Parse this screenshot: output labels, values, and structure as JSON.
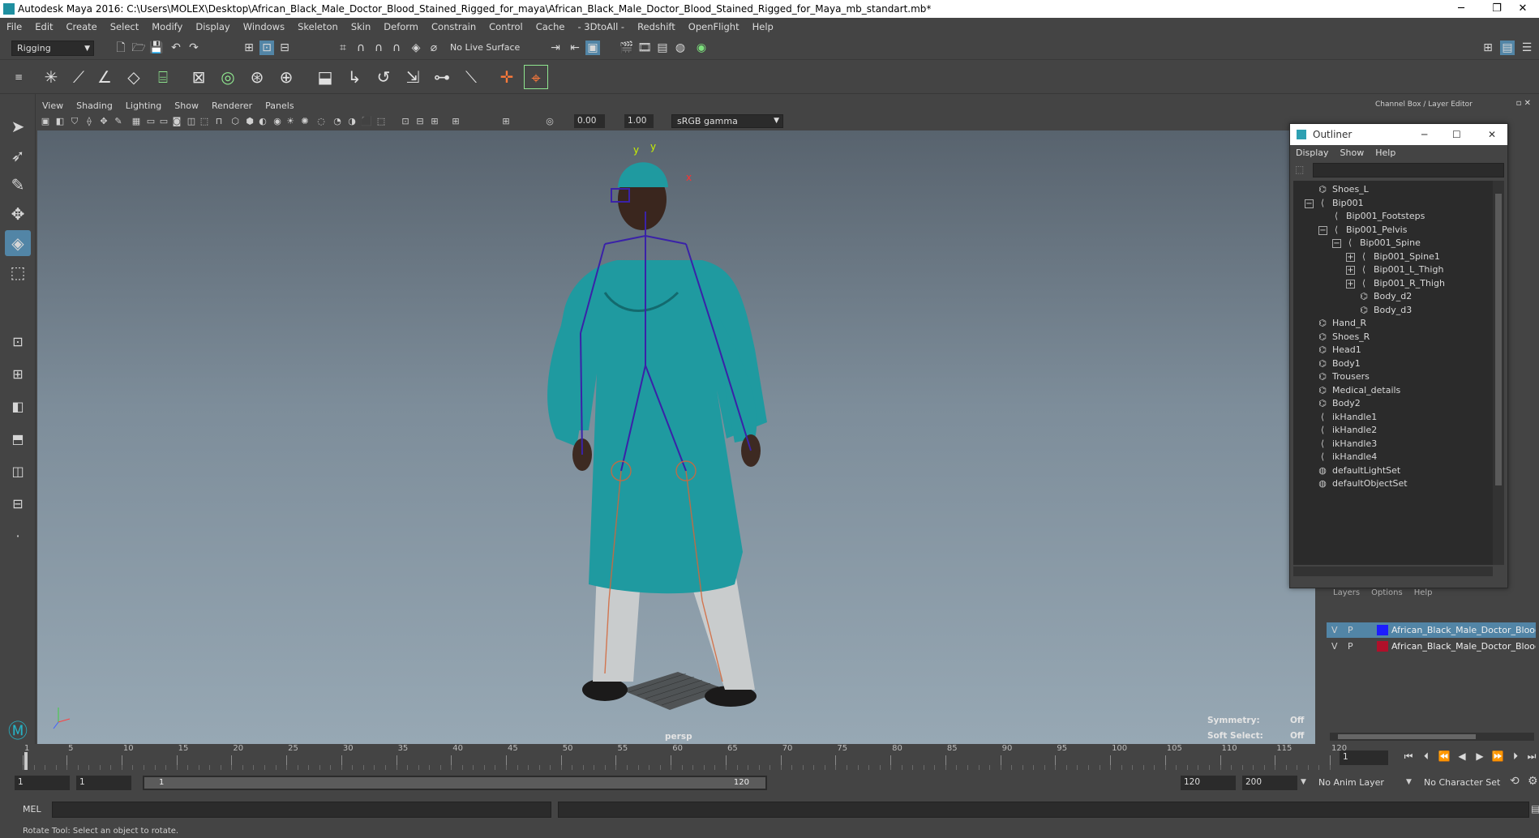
{
  "window": {
    "title": "Autodesk Maya 2016: C:\\Users\\MOLEX\\Desktop\\African_Black_Male_Doctor_Blood_Stained_Rigged_for_maya\\African_Black_Male_Doctor_Blood_Stained_Rigged_for_Maya_mb_standart.mb*",
    "minimize": "─",
    "restore": "❐",
    "close": "✕"
  },
  "menubar": [
    "File",
    "Edit",
    "Create",
    "Select",
    "Modify",
    "Display",
    "Windows",
    "Skeleton",
    "Skin",
    "Deform",
    "Constrain",
    "Control",
    "Cache",
    "- 3DtoAll -",
    "Redshift",
    "OpenFlight",
    "Help"
  ],
  "statusline": {
    "menuset": "Rigging",
    "live_surface": "No Live Surface"
  },
  "viewport_panel": {
    "menus": [
      "View",
      "Shading",
      "Lighting",
      "Show",
      "Renderer",
      "Panels"
    ],
    "exposure": "0.00",
    "gamma": "1.00",
    "color_space": "sRGB gamma",
    "camera_label": "persp",
    "symmetry_label": "Symmetry:",
    "symmetry_value": "Off",
    "soft_select_label": "Soft Select:",
    "soft_select_value": "Off"
  },
  "channelbox": {
    "title": "Channel Box / Layer Editor",
    "layer_menus": [
      "Layers",
      "Options",
      "Help"
    ],
    "layers": [
      {
        "v": "V",
        "p": "P",
        "color": "#1d1dff",
        "name": "African_Black_Male_Doctor_Blood_Stained",
        "selected": true
      },
      {
        "v": "V",
        "p": "P",
        "color": "#b0102a",
        "name": "African_Black_Male_Doctor_Blood",
        "selected": false
      }
    ]
  },
  "outliner": {
    "title": "Outliner",
    "menus": [
      "Display",
      "Show",
      "Help"
    ],
    "items": [
      {
        "label": "Shoes_L",
        "indent": 0,
        "icon": "mesh-icon"
      },
      {
        "label": "Bip001",
        "indent": 0,
        "icon": "joint-icon",
        "expander": "−"
      },
      {
        "label": "Bip001_Footsteps",
        "indent": 1,
        "icon": "joint-icon"
      },
      {
        "label": "Bip001_Pelvis",
        "indent": 1,
        "icon": "joint-icon",
        "expander": "−"
      },
      {
        "label": "Bip001_Spine",
        "indent": 2,
        "icon": "joint-icon",
        "expander": "−"
      },
      {
        "label": "Bip001_Spine1",
        "indent": 3,
        "icon": "joint-icon",
        "expander": "+"
      },
      {
        "label": "Bip001_L_Thigh",
        "indent": 3,
        "icon": "joint-icon",
        "expander": "+"
      },
      {
        "label": "Bip001_R_Thigh",
        "indent": 3,
        "icon": "joint-icon",
        "expander": "+"
      },
      {
        "label": "Body_d2",
        "indent": 3,
        "icon": "mesh-icon"
      },
      {
        "label": "Body_d3",
        "indent": 3,
        "icon": "mesh-icon"
      },
      {
        "label": "Hand_R",
        "indent": 0,
        "icon": "mesh-icon"
      },
      {
        "label": "Shoes_R",
        "indent": 0,
        "icon": "mesh-icon"
      },
      {
        "label": "Head1",
        "indent": 0,
        "icon": "mesh-icon"
      },
      {
        "label": "Body1",
        "indent": 0,
        "icon": "mesh-icon"
      },
      {
        "label": "Trousers",
        "indent": 0,
        "icon": "mesh-icon"
      },
      {
        "label": "Medical_details",
        "indent": 0,
        "icon": "mesh-icon"
      },
      {
        "label": "Body2",
        "indent": 0,
        "icon": "mesh-icon"
      },
      {
        "label": "ikHandle1",
        "indent": 0,
        "icon": "ikhandle-icon"
      },
      {
        "label": "ikHandle2",
        "indent": 0,
        "icon": "ikhandle-icon"
      },
      {
        "label": "ikHandle3",
        "indent": 0,
        "icon": "ikhandle-icon"
      },
      {
        "label": "ikHandle4",
        "indent": 0,
        "icon": "ikhandle-icon"
      },
      {
        "label": "defaultLightSet",
        "indent": 0,
        "icon": "set-icon"
      },
      {
        "label": "defaultObjectSet",
        "indent": 0,
        "icon": "set-icon"
      }
    ]
  },
  "timeline": {
    "ticks": [
      "1",
      "5",
      "10",
      "15",
      "20",
      "25",
      "30",
      "35",
      "40",
      "45",
      "50",
      "55",
      "60",
      "65",
      "70",
      "75",
      "80",
      "85",
      "90",
      "95",
      "100",
      "105",
      "110",
      "115",
      "120"
    ],
    "current_frame": "1"
  },
  "range": {
    "start": "1",
    "playback_start": "1",
    "slider_start": "1",
    "slider_end": "120",
    "playback_end": "120",
    "end": "200",
    "anim_layer": "No Anim Layer",
    "character_set": "No Character Set"
  },
  "cmdline": {
    "mode": "MEL"
  },
  "helpline": {
    "text": "Rotate Tool: Select an object to rotate."
  }
}
